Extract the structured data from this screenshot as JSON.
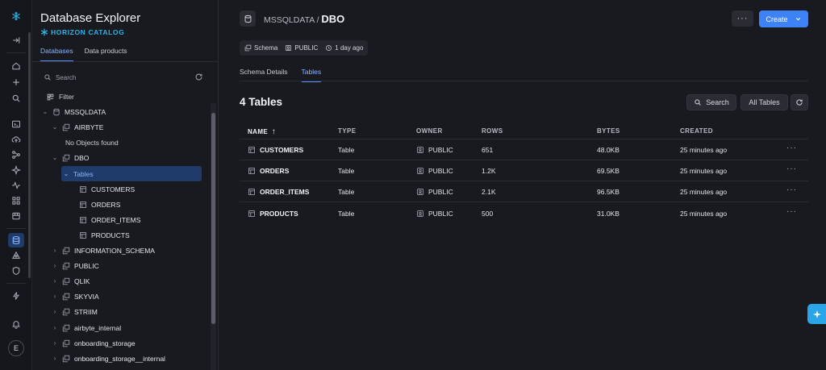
{
  "explorer": {
    "title": "Database Explorer",
    "subtitle": "HORIZON CATALOG",
    "tabs": [
      "Databases",
      "Data products"
    ],
    "search_placeholder": "Search",
    "filter_label": "Filter",
    "tree": [
      {
        "label": "MSSQLDATA",
        "level": 0,
        "expanded": true,
        "icon": "database-icon"
      },
      {
        "label": "AIRBYTE",
        "level": 1,
        "expanded": true,
        "icon": "schema-icon"
      },
      {
        "label": "No Objects found",
        "level": 2,
        "icon": ""
      },
      {
        "label": "DBO",
        "level": 1,
        "expanded": true,
        "icon": "schema-icon"
      },
      {
        "label": "Tables",
        "level": 2,
        "expanded": true,
        "selected": true,
        "icon": ""
      },
      {
        "label": "CUSTOMERS",
        "level": 3,
        "icon": "table-icon"
      },
      {
        "label": "ORDERS",
        "level": 3,
        "icon": "table-icon"
      },
      {
        "label": "ORDER_ITEMS",
        "level": 3,
        "icon": "table-icon"
      },
      {
        "label": "PRODUCTS",
        "level": 3,
        "icon": "table-icon"
      },
      {
        "label": "INFORMATION_SCHEMA",
        "level": 1,
        "expanded": false,
        "icon": "schema-icon"
      },
      {
        "label": "PUBLIC",
        "level": 1,
        "expanded": false,
        "icon": "schema-icon"
      },
      {
        "label": "QLIK",
        "level": 1,
        "expanded": false,
        "icon": "schema-icon"
      },
      {
        "label": "SKYVIA",
        "level": 1,
        "expanded": false,
        "icon": "schema-icon"
      },
      {
        "label": "STRIIM",
        "level": 1,
        "expanded": false,
        "icon": "schema-icon"
      },
      {
        "label": "airbyte_internal",
        "level": 1,
        "expanded": false,
        "icon": "schema-icon"
      },
      {
        "label": "onboarding_storage",
        "level": 1,
        "expanded": false,
        "icon": "schema-icon"
      },
      {
        "label": "onboarding_storage__internal",
        "level": 1,
        "expanded": false,
        "icon": "schema-icon"
      }
    ]
  },
  "rail": {
    "avatar_initial": "E"
  },
  "header": {
    "database": "MSSQLDATA",
    "separator": "/",
    "schema": "DBO",
    "more_label": "···",
    "create_label": "Create"
  },
  "chips": {
    "type": "Schema",
    "owner": "PUBLIC",
    "age": "1 day ago"
  },
  "tabs": [
    "Schema Details",
    "Tables"
  ],
  "tables_section": {
    "count_title": "4 Tables",
    "search_label": "Search",
    "filter_label": "All Tables"
  },
  "table": {
    "columns": [
      "NAME",
      "TYPE",
      "OWNER",
      "ROWS",
      "BYTES",
      "CREATED"
    ],
    "sort_arrow": "↑",
    "rows": [
      {
        "name": "CUSTOMERS",
        "type": "Table",
        "owner": "PUBLIC",
        "rows": "651",
        "bytes": "48.0KB",
        "created": "25 minutes ago"
      },
      {
        "name": "ORDERS",
        "type": "Table",
        "owner": "PUBLIC",
        "rows": "1.2K",
        "bytes": "69.5KB",
        "created": "25 minutes ago"
      },
      {
        "name": "ORDER_ITEMS",
        "type": "Table",
        "owner": "PUBLIC",
        "rows": "2.1K",
        "bytes": "96.5KB",
        "created": "25 minutes ago"
      },
      {
        "name": "PRODUCTS",
        "type": "Table",
        "owner": "PUBLIC",
        "rows": "500",
        "bytes": "31.0KB",
        "created": "25 minutes ago"
      }
    ],
    "row_menu": "···"
  },
  "colors": {
    "accent": "#3d82f6",
    "brand": "#29b5e8",
    "background": "#191a20",
    "selected": "#1f3b6a"
  }
}
